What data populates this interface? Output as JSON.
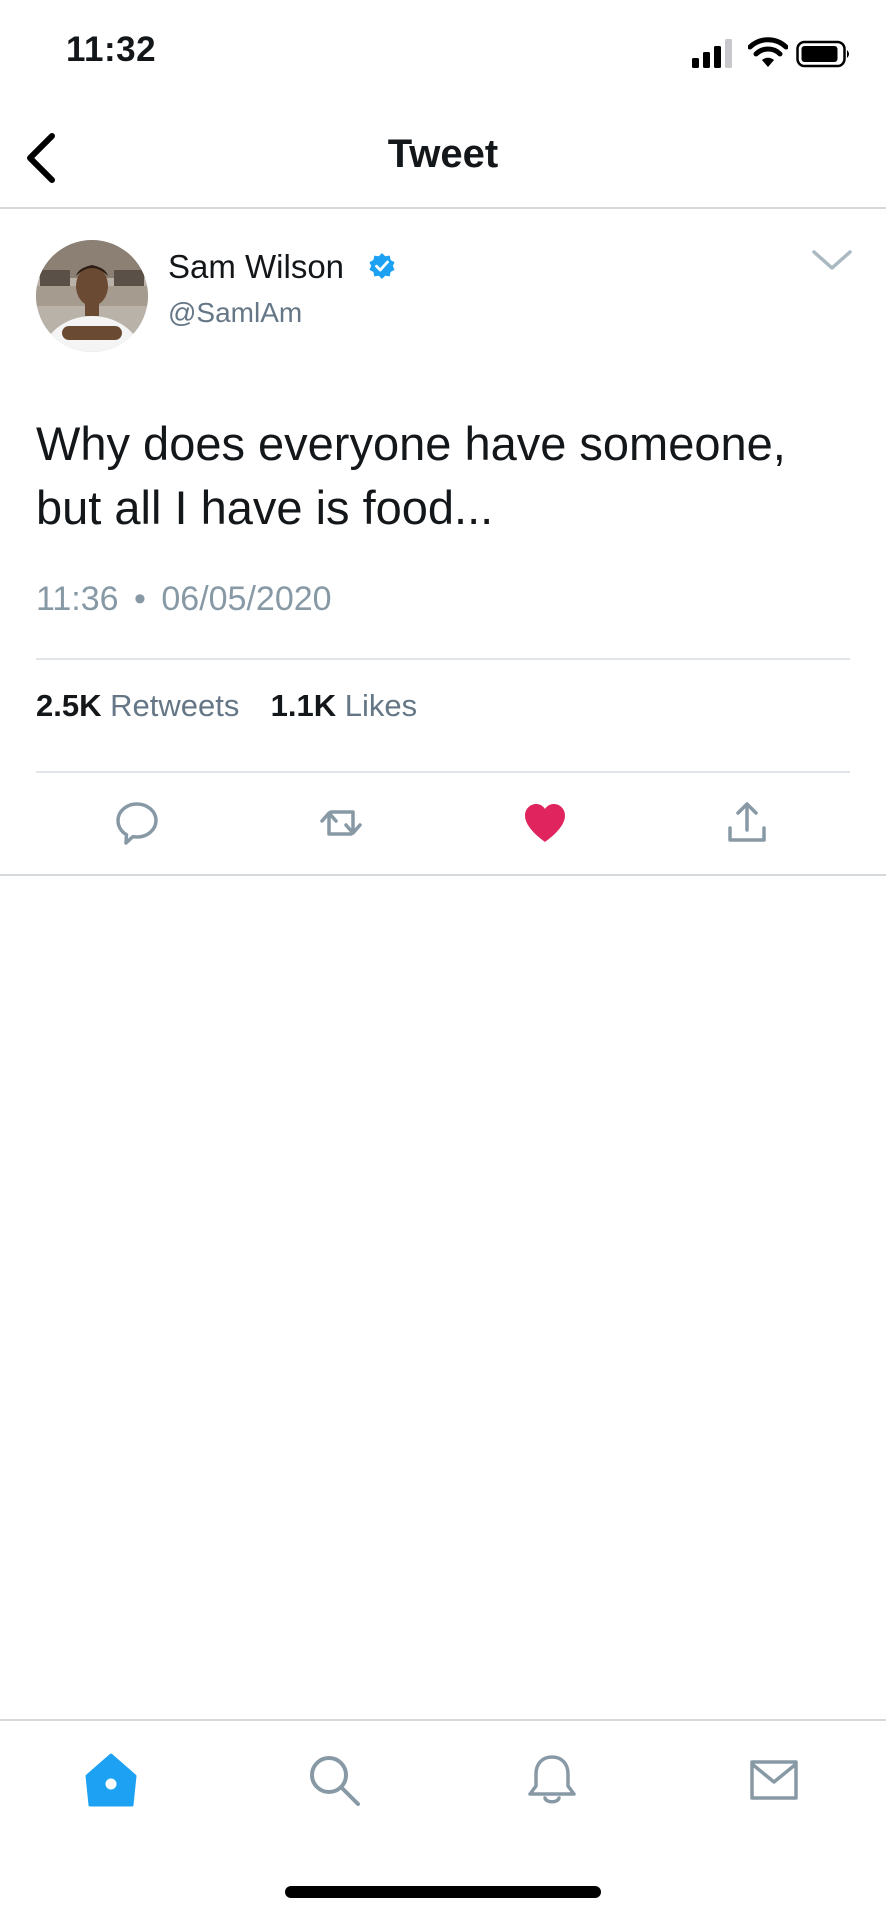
{
  "status_bar": {
    "time": "11:32",
    "icons": [
      "cellular-signal-icon",
      "wifi-icon",
      "battery-icon"
    ]
  },
  "nav": {
    "back_icon": "chevron-left-icon",
    "title": "Tweet"
  },
  "tweet": {
    "author_name": "Sam Wilson",
    "handle": "@SamlAm",
    "verified": true,
    "text": "Why does everyone have someone, but all I have is food...",
    "time": "11:36",
    "separator": "•",
    "date": "06/05/2020",
    "retweets_count": "2.5K",
    "retweets_label": "Retweets",
    "likes_count": "1.1K",
    "likes_label": "Likes",
    "liked": true
  },
  "actions": [
    "reply-icon",
    "retweet-icon",
    "like-heart-icon",
    "share-icon"
  ],
  "tab_bar": {
    "tabs": [
      "home-icon",
      "search-icon",
      "notifications-bell-icon",
      "messages-envelope-icon"
    ],
    "active": "home-icon"
  },
  "colors": {
    "accent": "#1da1f2",
    "like": "#e0245e",
    "secondary_text": "#657786",
    "icon_gray": "#8899a6",
    "divider": "#e1e4e8"
  }
}
